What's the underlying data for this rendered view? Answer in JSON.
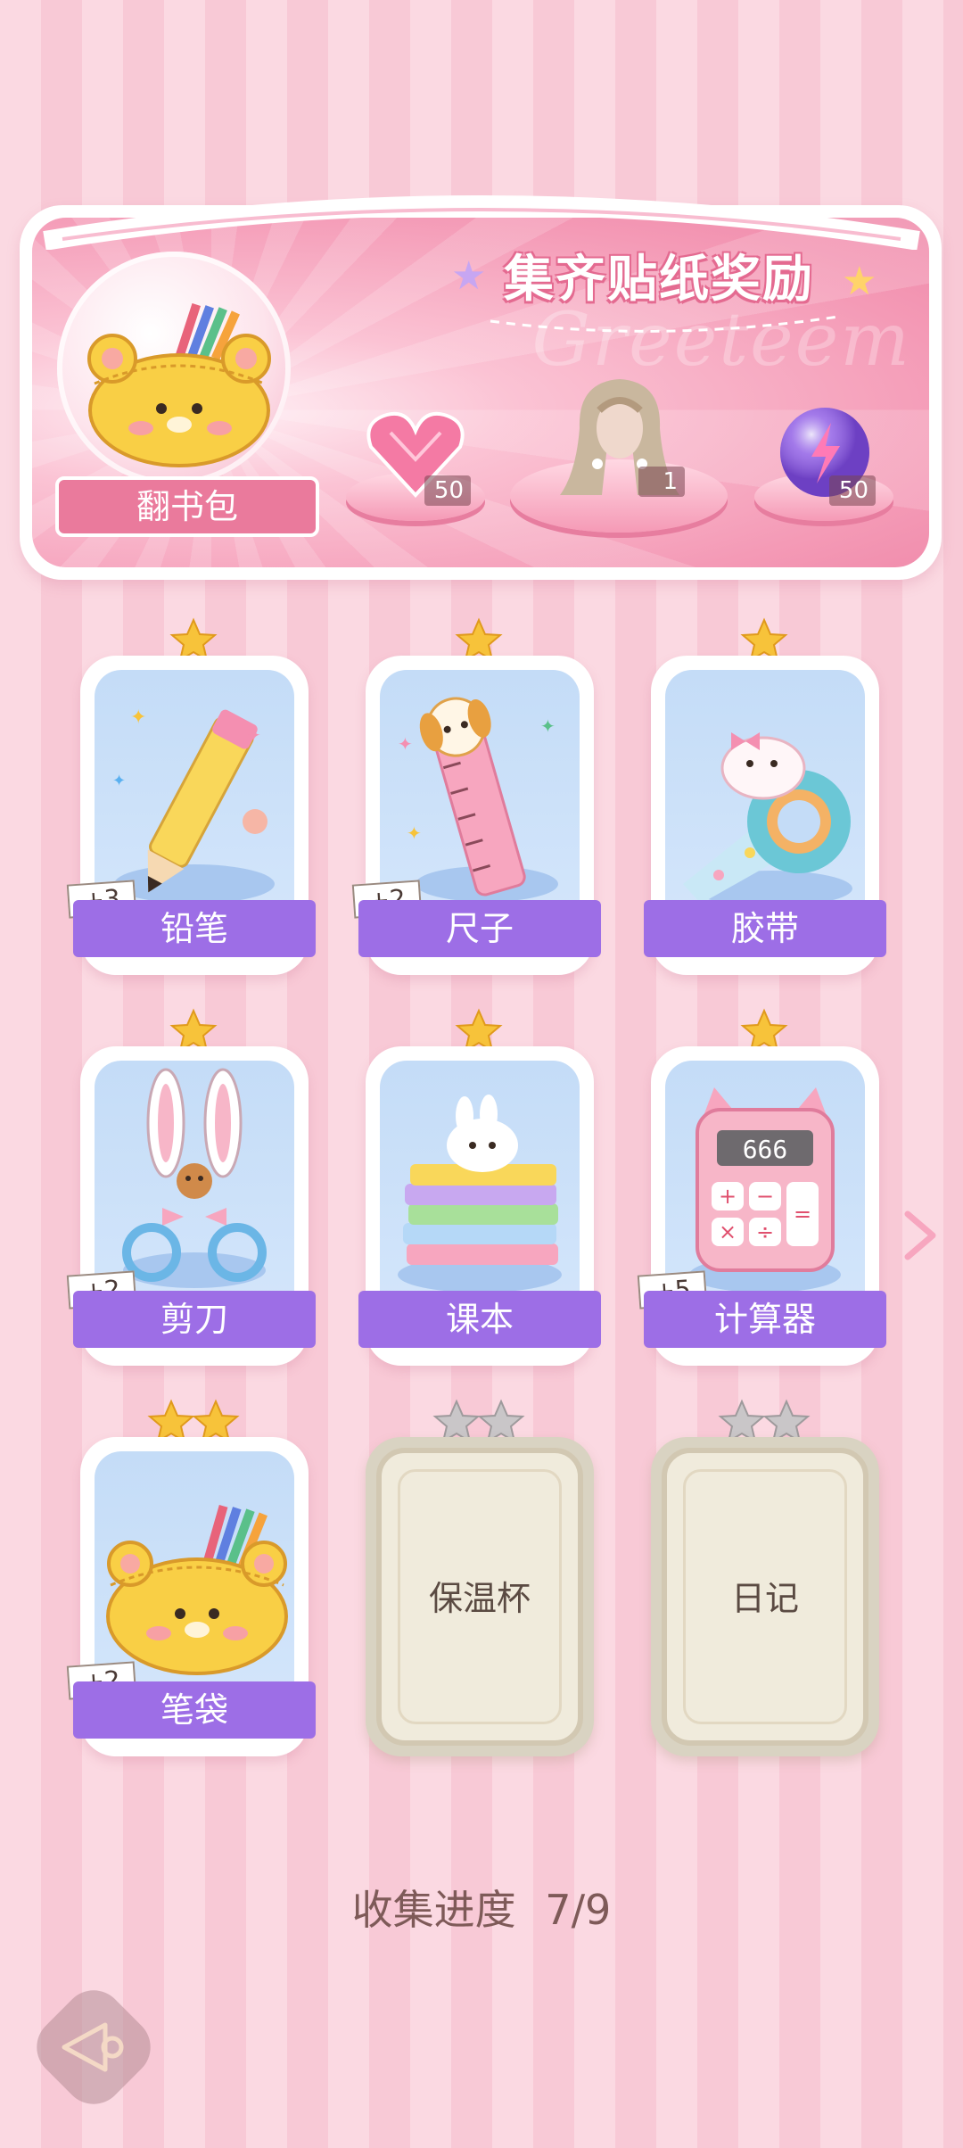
{
  "banner": {
    "title": "集齐贴纸奖励",
    "watermark": "Greeteem",
    "main_reward_label": "翻书包",
    "rewards": [
      {
        "icon": "heart-gem-icon",
        "count": "50"
      },
      {
        "icon": "hairstyle-icon",
        "count": "1"
      },
      {
        "icon": "energy-orb-icon",
        "count": "50"
      }
    ]
  },
  "stickers": [
    {
      "name": "铅笔",
      "plus": "+3",
      "stars": 1,
      "collected": true,
      "icon": "pencil-icon"
    },
    {
      "name": "尺子",
      "plus": "+2",
      "stars": 1,
      "collected": true,
      "icon": "ruler-icon"
    },
    {
      "name": "胶带",
      "plus": "",
      "stars": 1,
      "collected": true,
      "icon": "tape-icon"
    },
    {
      "name": "剪刀",
      "plus": "+2",
      "stars": 1,
      "collected": true,
      "icon": "scissors-icon"
    },
    {
      "name": "课本",
      "plus": "",
      "stars": 1,
      "collected": true,
      "icon": "textbook-icon"
    },
    {
      "name": "计算器",
      "plus": "+5",
      "stars": 1,
      "collected": true,
      "icon": "calculator-icon",
      "calc_display": "666"
    },
    {
      "name": "笔袋",
      "plus": "+2",
      "stars": 2,
      "collected": true,
      "icon": "pencil-case-icon"
    },
    {
      "name": "保温杯",
      "stars": 2,
      "collected": false
    },
    {
      "name": "日记",
      "stars": 2,
      "collected": false
    }
  ],
  "progress": {
    "label": "收集进度",
    "value": "7/9"
  },
  "colors": {
    "accent": "#9d6ee6",
    "pink": "#ea7a9c",
    "star_gold": "#f7c33a",
    "star_gray": "#c9c6c8"
  }
}
